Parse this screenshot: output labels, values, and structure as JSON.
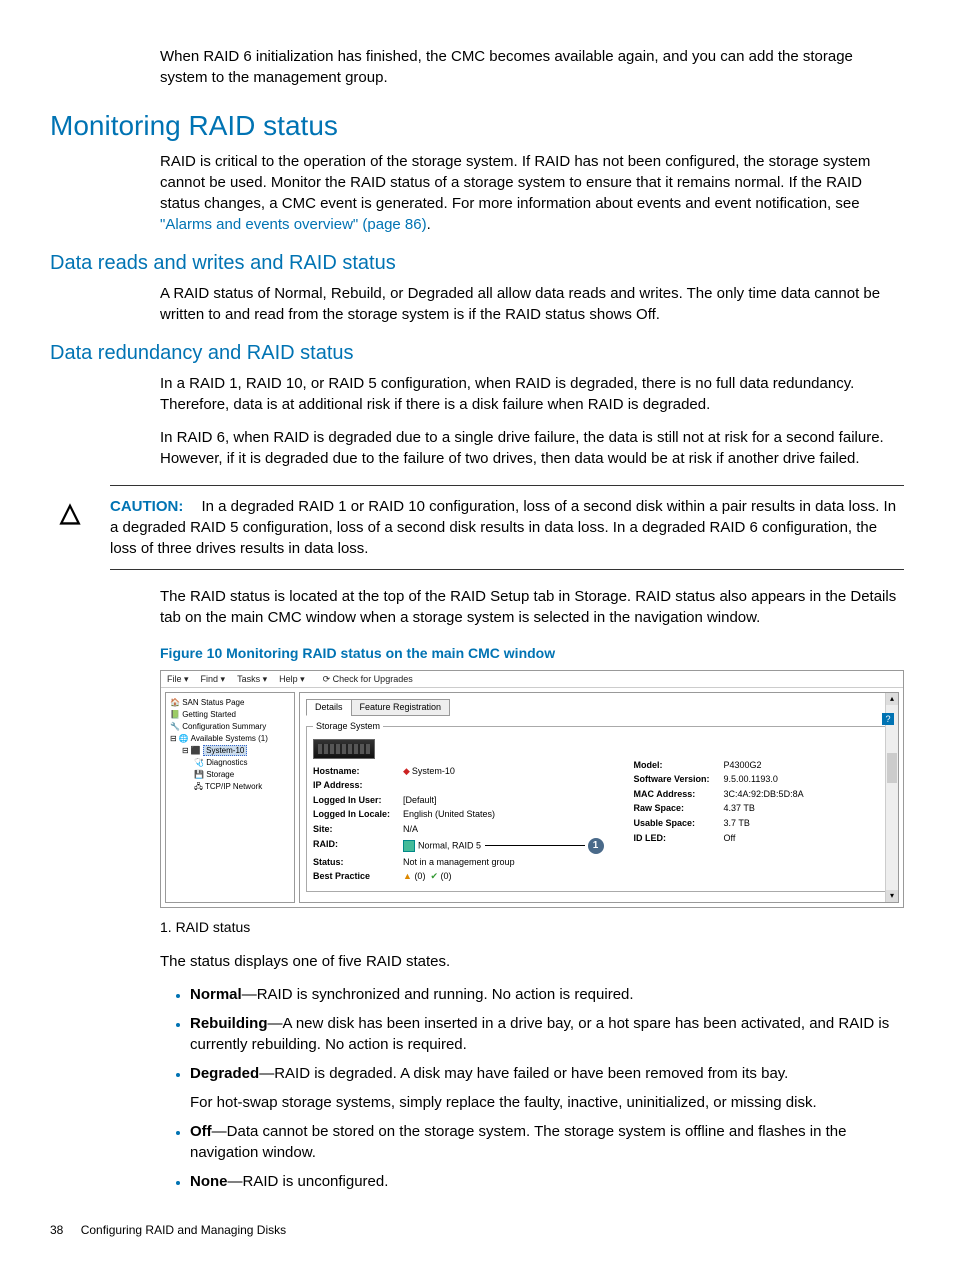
{
  "intro": "When RAID 6 initialization has finished, the CMC becomes available again, and you can add the storage system to the management group.",
  "h1": "Monitoring RAID status",
  "p1a": "RAID is critical to the operation of the storage system. If RAID has not been configured, the storage system cannot be used. Monitor the RAID status of a storage system to ensure that it remains normal. If the RAID status changes, a CMC event is generated. For more information about events and event notification, see ",
  "p1_link": "\"Alarms and events overview\" (page 86)",
  "p1b": ".",
  "h2a": "Data reads and writes and RAID status",
  "p2": "A RAID status of Normal, Rebuild, or Degraded all allow data reads and writes. The only time data cannot be written to and read from the storage system is if the RAID status shows Off.",
  "h2b": "Data redundancy and RAID status",
  "p3": "In a RAID 1, RAID 10, or RAID 5 configuration, when RAID is degraded, there is no full data redundancy. Therefore, data is at additional risk if there is a disk failure when RAID is degraded.",
  "p4": "In RAID 6, when RAID is degraded due to a single drive failure, the data is still not at risk for a second failure. However, if it is degraded due to the failure of two drives, then data would be at risk if another drive failed.",
  "caution_label": "CAUTION:",
  "caution_text": "In a degraded RAID 1 or RAID 10 configuration, loss of a second disk within a pair results in data loss. In a degraded RAID 5 configuration, loss of a second disk results in data loss. In a degraded RAID 6 configuration, the loss of three drives results in data loss.",
  "p5": "The RAID status is located at the top of the RAID Setup tab in Storage. RAID status also appears in the Details tab on the main CMC window when a storage system is selected in the navigation window.",
  "figure_title": "Figure 10 Monitoring RAID status on the main CMC window",
  "menubar": {
    "file": "File ▾",
    "find": "Find ▾",
    "tasks": "Tasks ▾",
    "help": "Help ▾",
    "check": "Check for Upgrades"
  },
  "tree": {
    "san": "SAN Status Page",
    "getting": "Getting Started",
    "config": "Configuration Summary",
    "avail": "Available Systems (1)",
    "system": "System-10",
    "diag": "Diagnostics",
    "storage": "Storage",
    "tcpip": "TCP/IP Network"
  },
  "tabs": {
    "details": "Details",
    "feature": "Feature Registration"
  },
  "fieldset_legend": "Storage System",
  "left_fields": {
    "hostname_l": "Hostname:",
    "hostname_v": "System-10",
    "ip_l": "IP Address:",
    "ip_v": " ",
    "user_l": "Logged In User:",
    "user_v": "[Default]",
    "locale_l": "Logged In Locale:",
    "locale_v": "English (United States)",
    "site_l": "Site:",
    "site_v": "N/A",
    "raid_l": "RAID:",
    "raid_v": "Normal, RAID 5",
    "status_l": "Status:",
    "status_v": "Not in a management group",
    "bp_l": "Best Practice",
    "bp_warn": "(0)",
    "bp_ok": "(0)"
  },
  "right_fields": {
    "model_l": "Model:",
    "model_v": "P4300G2",
    "sw_l": "Software Version:",
    "sw_v": "9.5.00.1193.0",
    "mac_l": "MAC Address:",
    "mac_v": "3C:4A:92:DB:5D:8A",
    "raw_l": "Raw Space:",
    "raw_v": "4.37 TB",
    "usable_l": "Usable Space:",
    "usable_v": "3.7 TB",
    "led_l": "ID LED:",
    "led_v": "Off"
  },
  "callout_1": "1",
  "legend_1": "1. RAID status",
  "p6": "The status displays one of five RAID states.",
  "states": [
    {
      "name": "Normal",
      "desc": "—RAID is synchronized and running. No action is required."
    },
    {
      "name": "Rebuilding",
      "desc": "—A new disk has been inserted in a drive bay, or a hot spare has been activated, and RAID is currently rebuilding. No action is required."
    },
    {
      "name": "Degraded",
      "desc": "—RAID is degraded. A disk may have failed or have been removed from its bay.",
      "extra": "For hot-swap storage systems, simply replace the faulty, inactive, uninitialized, or missing disk."
    },
    {
      "name": "Off",
      "desc": "—Data cannot be stored on the storage system. The storage system is offline and flashes in the navigation window."
    },
    {
      "name": "None",
      "desc": "—RAID is unconfigured."
    }
  ],
  "footer_page": "38",
  "footer_title": "Configuring RAID and Managing Disks"
}
